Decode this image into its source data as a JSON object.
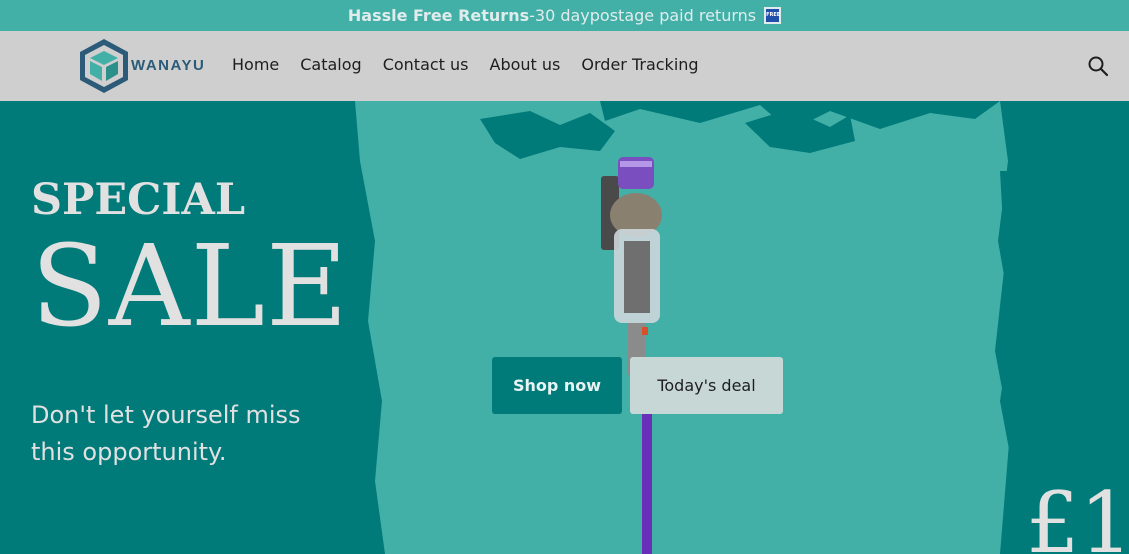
{
  "announcement": {
    "bold": "Hassle Free Returns",
    "rest": "-30 daypostage paid returns",
    "icon": "free-badge-icon",
    "icon_text": "FREE"
  },
  "header": {
    "logo_text": "WANAYU",
    "nav": [
      {
        "label": "Home"
      },
      {
        "label": "Catalog"
      },
      {
        "label": "Contact us"
      },
      {
        "label": "About us"
      },
      {
        "label": "Order Tracking"
      }
    ],
    "search_icon": "search-icon"
  },
  "hero": {
    "kicker": "SPECIAL",
    "headline": "SALE",
    "tagline": "Don't let yourself miss this opportunity.",
    "primary_button": "Shop now",
    "secondary_button": "Today's deal",
    "price_partial": "£1",
    "product_image": "cordless-stick-vacuum"
  },
  "colors": {
    "brand_teal": "#017a7a",
    "light_teal": "#43b0a8",
    "header_gray": "#cfcfcf",
    "button_light": "#c6d7d5"
  }
}
